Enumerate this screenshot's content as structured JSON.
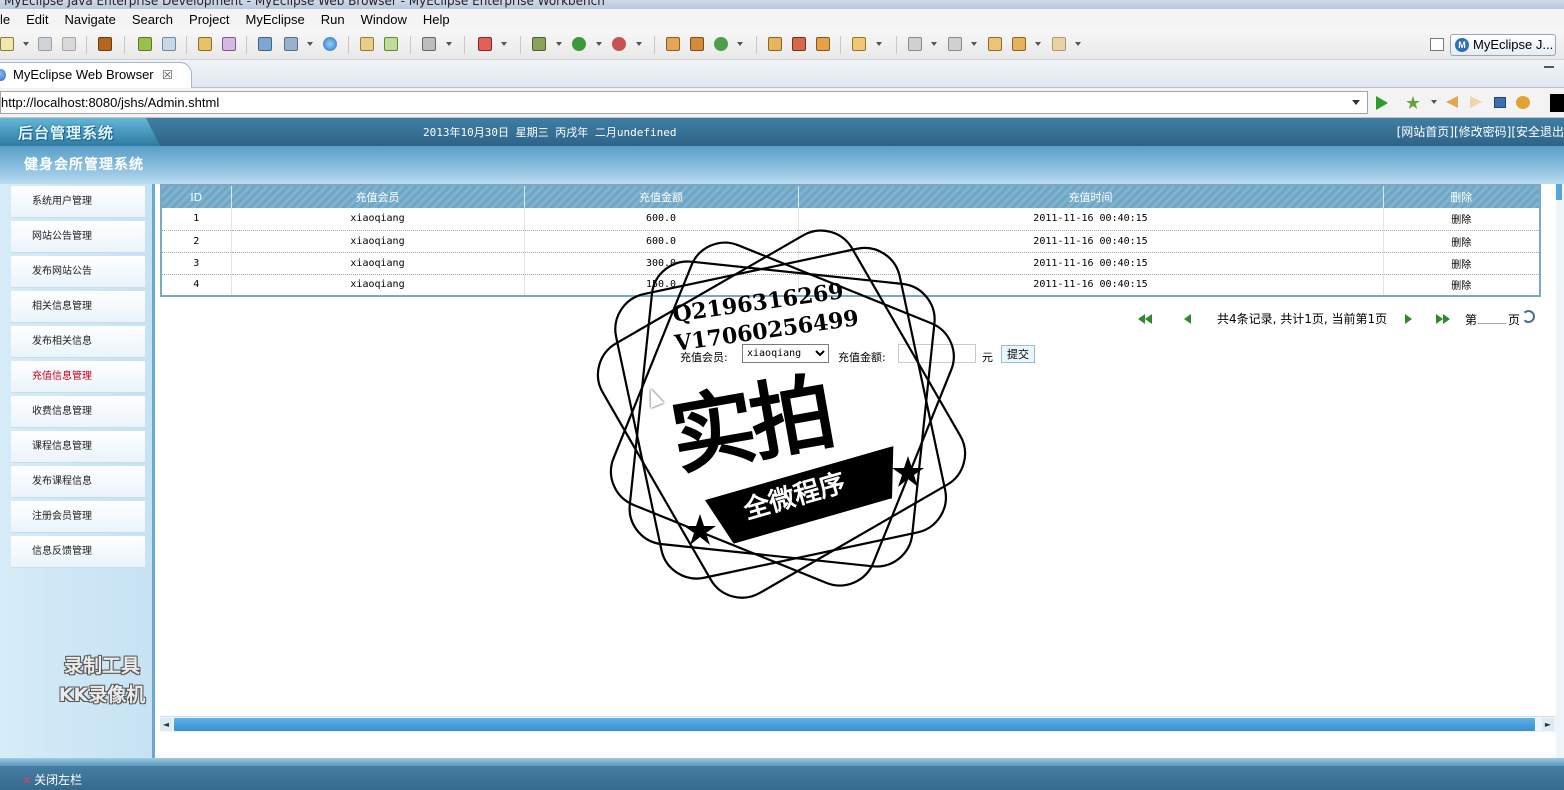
{
  "window": {
    "title": "MyEclipse Java Enterprise Development - MyEclipse Web Browser - MyEclipse Enterprise Workbench"
  },
  "menubar": {
    "items": [
      "le",
      "Edit",
      "Navigate",
      "Search",
      "Project",
      "MyEclipse",
      "Run",
      "Window",
      "Help"
    ]
  },
  "toolbar": {
    "perspective_label": "MyEclipse J..."
  },
  "tab": {
    "label": "MyEclipse Web Browser",
    "close": "☒"
  },
  "browser": {
    "url": "http://localhost:8080/jshs/Admin.shtml"
  },
  "header": {
    "logo": "后台管理系统",
    "date": "2013年10月30日 星期三 丙戌年 二月undefined",
    "links": {
      "home": "[网站首页]",
      "password": "[修改密码]",
      "logout": "[安全退出"
    },
    "system_title": "健身会所管理系统"
  },
  "nav": {
    "items": [
      {
        "label": "系统用户管理"
      },
      {
        "label": "网站公告管理"
      },
      {
        "label": "发布网站公告"
      },
      {
        "label": "相关信息管理"
      },
      {
        "label": "发布相关信息"
      },
      {
        "label": "充值信息管理",
        "active": true
      },
      {
        "label": "收费信息管理"
      },
      {
        "label": "课程信息管理"
      },
      {
        "label": "发布课程信息"
      },
      {
        "label": "注册会员管理"
      },
      {
        "label": "信息反馈管理"
      }
    ]
  },
  "table": {
    "headers": [
      "ID",
      "充值会员",
      "充值金额",
      "充值时间",
      "删除"
    ],
    "rows": [
      {
        "id": "1",
        "member": "xiaoqiang",
        "amount": "600.0",
        "time": "2011-11-16 00:40:15",
        "action": "删除"
      },
      {
        "id": "2",
        "member": "xiaoqiang",
        "amount": "600.0",
        "time": "2011-11-16 00:40:15",
        "action": "删除"
      },
      {
        "id": "3",
        "member": "xiaoqiang",
        "amount": "300.0",
        "time": "2011-11-16 00:40:15",
        "action": "删除"
      },
      {
        "id": "4",
        "member": "xiaoqiang",
        "amount": "150.0",
        "time": "2011-11-16 00:40:15",
        "action": "删除"
      }
    ]
  },
  "pager": {
    "summary": "共4条记录, 共计1页, 当前第1页",
    "page_prefix": "第",
    "page_suffix": "页",
    "page_value": ""
  },
  "form": {
    "member_label": "充值会员:",
    "member_selected": "xiaoqiang",
    "amount_label": "充值金额:",
    "amount_value": "",
    "unit": "元",
    "submit_label": "提交"
  },
  "footer": {
    "close_left": "关闭左栏",
    "close_mark": "×"
  },
  "watermarks": {
    "recorder_line1": "录制工具",
    "recorder_line2": "KK录像机",
    "stamp_qq": "Q2196316269",
    "stamp_vx": "V17060256499",
    "stamp_big": "实拍",
    "stamp_sub": "全微程序"
  },
  "colors": {
    "header_blue": "#2e6488",
    "nav_bg": "#d6ecf8",
    "table_header": "#7fb3cf",
    "active_nav": "#c4001a",
    "scroll_thumb": "#3a8fd0"
  }
}
